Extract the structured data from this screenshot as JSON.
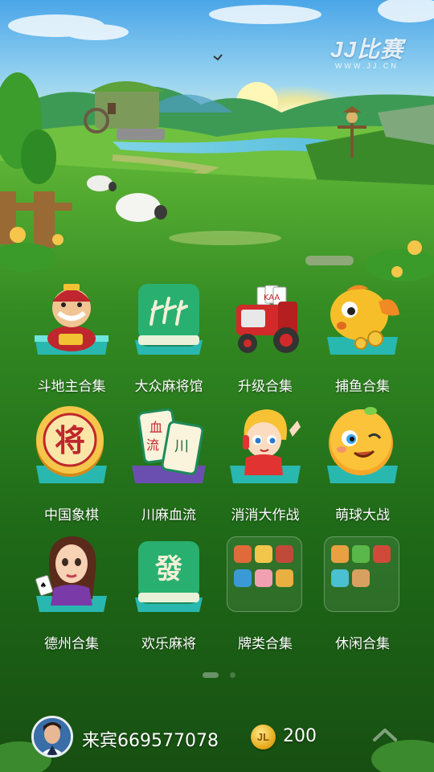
{
  "brand": {
    "logo_text": "JJ比赛",
    "logo_url": "WWW.JJ.CN"
  },
  "games": [
    {
      "label": "斗地主合集",
      "icon": "landlord-character-icon"
    },
    {
      "label": "大众麻将馆",
      "icon": "mahjong-bamboo-tile-icon"
    },
    {
      "label": "升级合集",
      "icon": "tractor-cards-icon"
    },
    {
      "label": "捕鱼合集",
      "icon": "golden-fish-icon"
    },
    {
      "label": "中国象棋",
      "icon": "chinese-chess-piece-icon"
    },
    {
      "label": "川麻血流",
      "icon": "sichuan-mahjong-tiles-icon"
    },
    {
      "label": "消消大作战",
      "icon": "match-girl-character-icon"
    },
    {
      "label": "萌球大战",
      "icon": "cute-ball-icon"
    },
    {
      "label": "德州合集",
      "icon": "poker-girl-icon"
    },
    {
      "label": "欢乐麻将",
      "icon": "fa-mahjong-tile-icon"
    },
    {
      "label": "牌类合集",
      "icon": "card-games-folder-icon"
    },
    {
      "label": "休闲合集",
      "icon": "casual-games-folder-icon"
    }
  ],
  "mahjong_glyphs": {
    "fa": "發",
    "xue": "血",
    "liu": "流",
    "chuan": "川"
  },
  "chess_glyph": "将",
  "tractor_cards": "KAA",
  "pager": {
    "pages": 2,
    "current": 1
  },
  "user": {
    "name": "来宾669577078",
    "coins": "200",
    "coin_symbol": "JL"
  },
  "colors": {
    "accent_teal": "#2fc3b8",
    "grass": "#2b7d1e",
    "coin": "#f2c230"
  }
}
